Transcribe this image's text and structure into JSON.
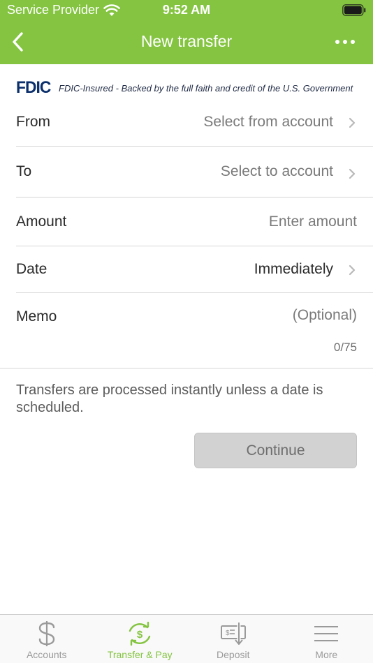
{
  "status_bar": {
    "carrier": "Service Provider",
    "time": "9:52 AM"
  },
  "nav": {
    "title": "New transfer",
    "back_icon": "chevron-left-icon",
    "more_icon": "ellipsis-icon"
  },
  "fdic": {
    "logo": "FDIC",
    "text": "FDIC-Insured - Backed by the full faith and credit of the U.S. Government"
  },
  "form": {
    "from": {
      "label": "From",
      "value": "Select from account"
    },
    "to": {
      "label": "To",
      "value": "Select to account"
    },
    "amount": {
      "label": "Amount",
      "placeholder": "Enter amount"
    },
    "date": {
      "label": "Date",
      "value": "Immediately"
    },
    "memo": {
      "label": "Memo",
      "placeholder": "(Optional)",
      "counter": "0/75"
    }
  },
  "info": "Transfers are processed instantly unless a date is scheduled.",
  "continue_label": "Continue",
  "colors": {
    "brand_green": "#84c441",
    "fdic_navy": "#0b2f6b",
    "tab_inactive": "#9a9a9a",
    "button_disabled": "#d2d2d2"
  },
  "tabs": [
    {
      "label": "Accounts",
      "icon": "dollar-icon",
      "active": false
    },
    {
      "label": "Transfer & Pay",
      "icon": "transfer-cycle-icon",
      "active": true
    },
    {
      "label": "Deposit",
      "icon": "check-deposit-icon",
      "active": false
    },
    {
      "label": "More",
      "icon": "menu-icon",
      "active": false
    }
  ]
}
